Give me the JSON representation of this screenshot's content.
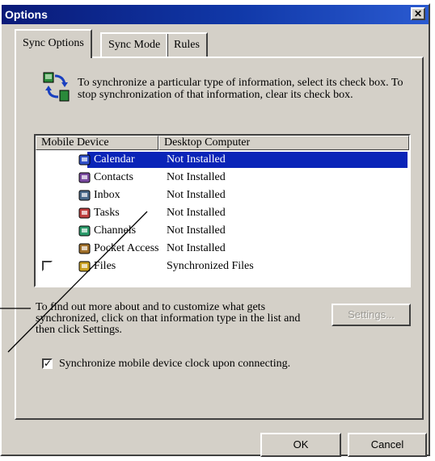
{
  "window": {
    "title": "Options",
    "close": "✕"
  },
  "tabs": [
    {
      "label": "Sync Options"
    },
    {
      "label": "Sync Mode"
    },
    {
      "label": "Rules"
    }
  ],
  "intro_text": "To synchronize a particular type of information, select its check box. To stop synchronization of that information, clear its check box.",
  "list": {
    "columns": [
      "Mobile Device",
      "Desktop Computer"
    ],
    "rows": [
      {
        "name": "Calendar",
        "status": "Not Installed",
        "icon": "calendar-icon",
        "selected": true
      },
      {
        "name": "Contacts",
        "status": "Not Installed",
        "icon": "contacts-icon"
      },
      {
        "name": "Inbox",
        "status": "Not Installed",
        "icon": "inbox-icon"
      },
      {
        "name": "Tasks",
        "status": "Not Installed",
        "icon": "tasks-icon"
      },
      {
        "name": "Channels",
        "status": "Not Installed",
        "icon": "channels-icon"
      },
      {
        "name": "Pocket Access",
        "status": "Not Installed",
        "icon": "pocket-access-icon"
      },
      {
        "name": "Files",
        "status": "Synchronized Files",
        "icon": "files-icon",
        "checkbox": true,
        "checked": false
      }
    ]
  },
  "info_text": "To find out more about and to customize what gets synchronized, click on that information type in the list and then click Settings.",
  "settings_button": "Settings...",
  "clock_option": {
    "label": "Synchronize mobile device clock upon connecting.",
    "checked": true
  },
  "buttons": {
    "ok": "OK",
    "cancel": "Cancel"
  },
  "check_mark": "✓"
}
